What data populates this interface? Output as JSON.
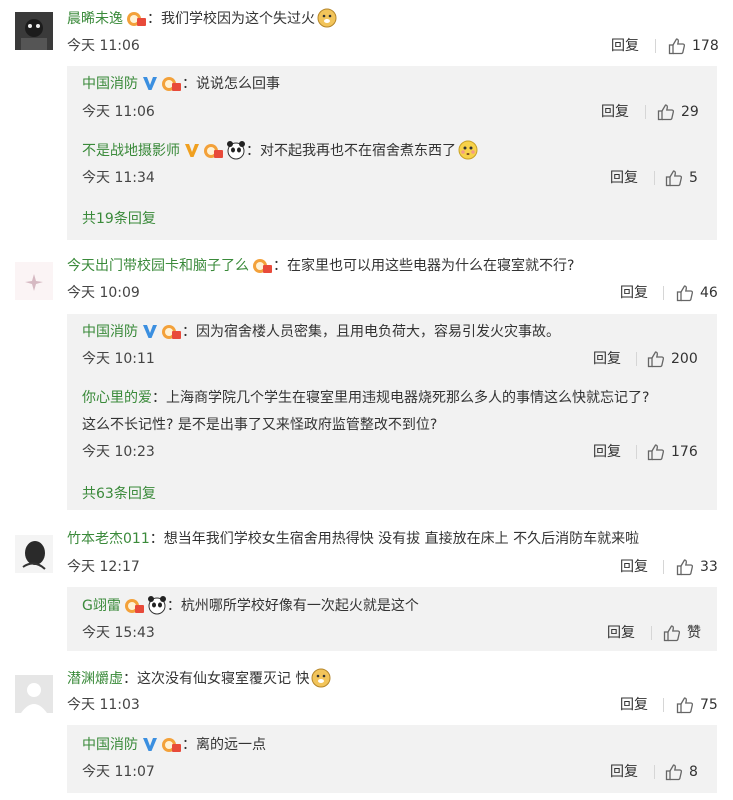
{
  "comments": [
    {
      "user": "晨晞未逸",
      "text": "：我们学校因为这个失过火",
      "time": "今天 11:06",
      "reply_label": "回复",
      "likes": "178",
      "replies": [
        {
          "user": "中国消防",
          "text": "：说说怎么回事",
          "time": "今天 11:06",
          "reply_label": "回复",
          "likes": "29"
        },
        {
          "user": "不是战地摄影师",
          "text": "：对不起我再也不在宿舍煮东西了",
          "time": "今天 11:34",
          "reply_label": "回复",
          "likes": "5"
        }
      ],
      "more": "共19条回复"
    },
    {
      "user": "今天出门带校园卡和脑子了么",
      "text": "：在家里也可以用这些电器为什么在寝室就不行?",
      "time": "今天 10:09",
      "reply_label": "回复",
      "likes": "46",
      "replies": [
        {
          "user": "中国消防",
          "text": "：因为宿舍楼人员密集，且用电负荷大，容易引发火灾事故。",
          "time": "今天 10:11",
          "reply_label": "回复",
          "likes": "200"
        },
        {
          "user": "你心里的爱",
          "text": "：上海商学院几个学生在寝室里用违规电器烧死那么多人的事情这么快就忘记了?",
          "text2": "这么不长记性? 是不是出事了又来怪政府监管整改不到位?",
          "time": "今天 10:23",
          "reply_label": "回复",
          "likes": "176"
        }
      ],
      "more": "共63条回复"
    },
    {
      "user": "竹本老杰011",
      "text": "：想当年我们学校女生宿舍用热得快 没有拔 直接放在床上 不久后消防车就来啦",
      "time": "今天 12:17",
      "reply_label": "回复",
      "likes": "33",
      "replies": [
        {
          "user": "G翊雷",
          "text": "：杭州哪所学校好像有一次起火就是这个",
          "time": "今天 15:43",
          "reply_label": "回复",
          "likes": "赞"
        }
      ]
    },
    {
      "user": "潜渊爝虚",
      "text": "：这次没有仙女寝室覆灭记 快",
      "time": "今天 11:03",
      "reply_label": "回复",
      "likes": "75",
      "replies": [
        {
          "user": "中国消防",
          "text": "：离的远一点",
          "time": "今天 11:07",
          "reply_label": "回复",
          "likes": "8"
        }
      ]
    }
  ],
  "colors": {
    "name": "#3a8a3a",
    "reply_bg": "#f2f2f2",
    "vip": "#e8771e",
    "verified": "#3b8fe0"
  },
  "icons": [
    "thumb-up-icon",
    "vip-badge-icon",
    "verified-v-icon",
    "doge-emoji-icon",
    "blush-emoji-icon",
    "panda-emoji-icon"
  ]
}
